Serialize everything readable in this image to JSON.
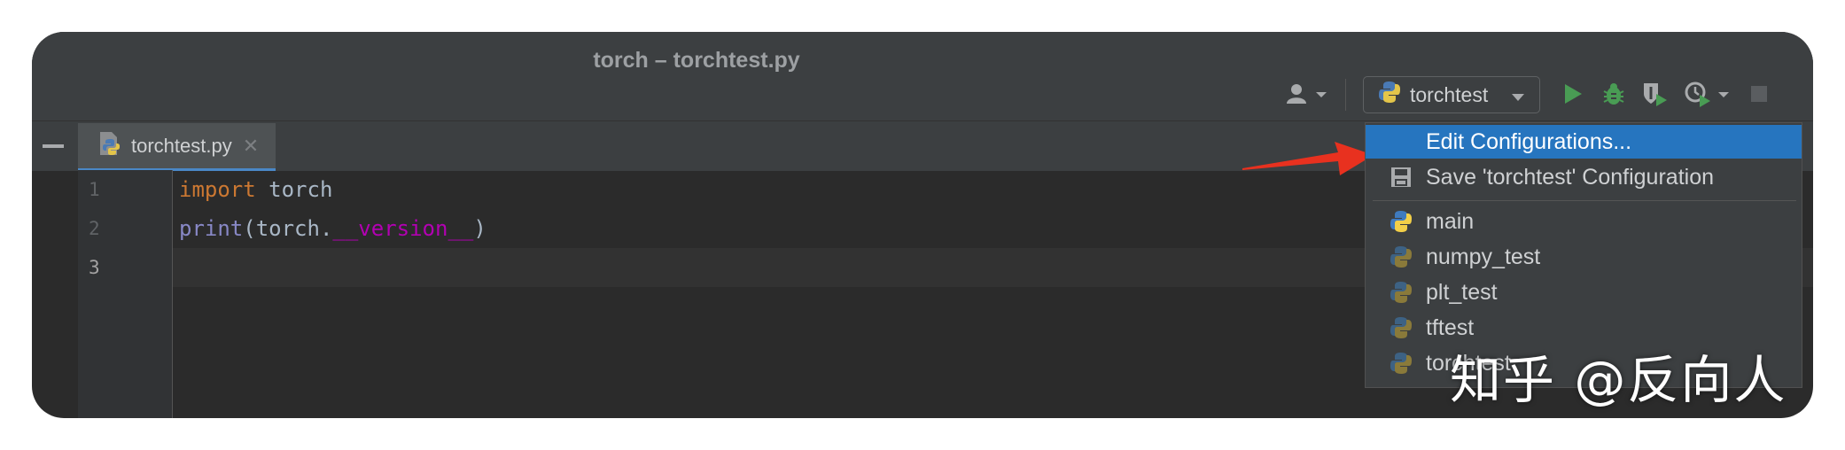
{
  "window": {
    "title": "torch – torchtest.py"
  },
  "toolbar": {
    "run_config_label": "torchtest",
    "icons": [
      "user-icon",
      "python-icon",
      "run-icon",
      "debug-icon",
      "coverage-icon",
      "profile-icon",
      "stop-icon"
    ]
  },
  "editor": {
    "tab": {
      "label": "torchtest.py",
      "close": "✕"
    },
    "line_numbers": [
      "1",
      "2",
      "3"
    ],
    "current_line": "3",
    "code": {
      "line1_keyword": "import",
      "line1_rest": " torch",
      "line2_builtin": "print",
      "line2_mid": "(torch.",
      "line2_dunder": "__version__",
      "line2_end": ")"
    }
  },
  "dropdown": {
    "items": [
      {
        "label": "Edit Configurations...",
        "selected": true
      },
      {
        "label": "Save 'torchtest' Configuration",
        "icon": "save-icon"
      },
      {
        "label": "main",
        "icon": "python-icon"
      },
      {
        "label": "numpy_test",
        "icon": "python-icon"
      },
      {
        "label": "plt_test",
        "icon": "python-icon"
      },
      {
        "label": "tftest",
        "icon": "python-icon"
      },
      {
        "label": "torchtest",
        "icon": "python-icon"
      }
    ]
  },
  "annotation": {
    "arrow_color": "#e8311f"
  },
  "watermark": {
    "text": "知乎 @反向人"
  },
  "colors": {
    "selection": "#2675bf",
    "keyword": "#cc7832",
    "builtin": "#8888c6",
    "dunder": "#b200b2"
  }
}
